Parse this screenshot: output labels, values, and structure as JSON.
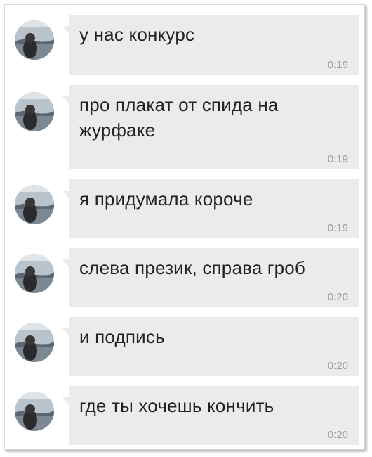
{
  "chat": {
    "messages": [
      {
        "text": "у нас конкурс",
        "time": "0:19"
      },
      {
        "text": "про плакат от спида на журфаке",
        "time": "0:19"
      },
      {
        "text": "я придумала короче",
        "time": "0:19"
      },
      {
        "text": "слева презик, справа гроб",
        "time": "0:20"
      },
      {
        "text": "и подпись",
        "time": "0:20"
      },
      {
        "text": "где ты хочешь кончить",
        "time": "0:20"
      }
    ]
  },
  "colors": {
    "bubble": "#ebebeb",
    "text": "#222222",
    "time": "#9c9c9c"
  },
  "icons": {
    "avatar": "avatar-photo"
  }
}
